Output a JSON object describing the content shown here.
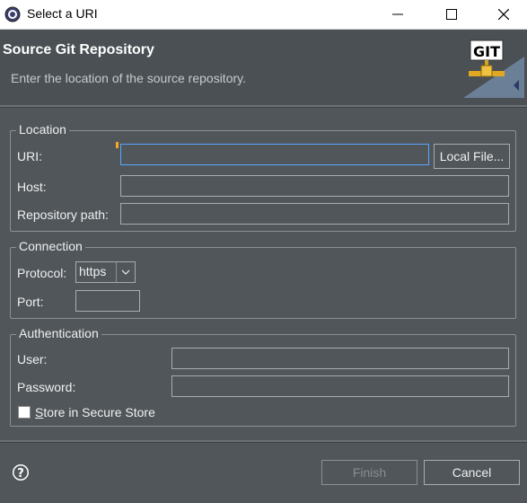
{
  "window": {
    "title": "Select a URI",
    "controls": {
      "minimize": "—",
      "maximize": "☐",
      "close": "✕"
    }
  },
  "header": {
    "title": "Source Git Repository",
    "description": "Enter the location of the source repository.",
    "banner_text": "GIT"
  },
  "location": {
    "legend": "Location",
    "uri_label": "URI:",
    "uri_value": "",
    "local_file_button": "Local File...",
    "host_label": "Host:",
    "host_value": "",
    "repo_path_label": "Repository path:",
    "repo_path_value": ""
  },
  "connection": {
    "legend": "Connection",
    "protocol_label": "Protocol:",
    "protocol_value": "https",
    "port_label": "Port:",
    "port_value": ""
  },
  "authentication": {
    "legend": "Authentication",
    "user_label": "User:",
    "user_value": "",
    "password_label": "Password:",
    "password_value": "",
    "store_label_mnemonic": "S",
    "store_label_rest": "tore in Secure Store",
    "store_checked": false
  },
  "footer": {
    "finish_button": "Finish",
    "cancel_button": "Cancel"
  }
}
